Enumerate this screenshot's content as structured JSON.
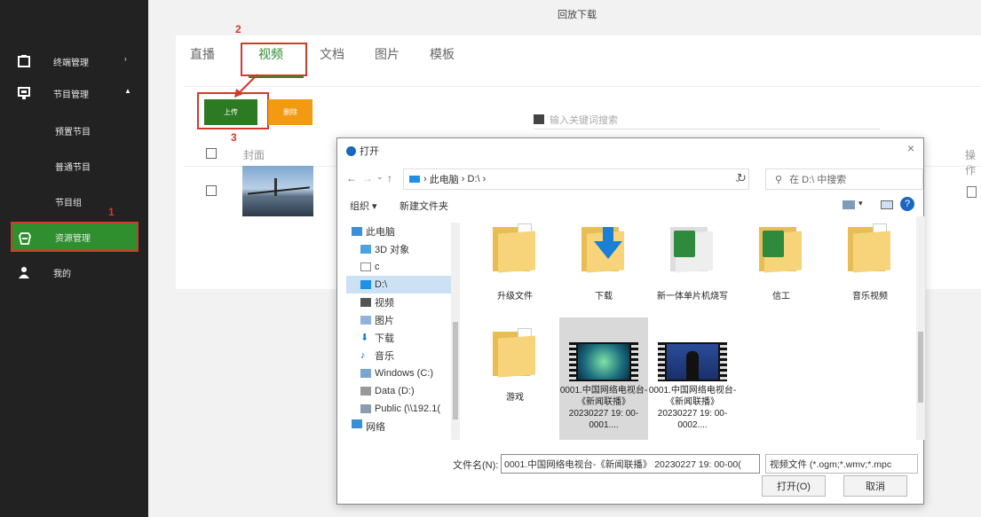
{
  "app": {
    "top_title": "回放下载"
  },
  "sidebar": {
    "items": [
      {
        "label": "终端管理",
        "icon": "terminal-icon"
      },
      {
        "label": "节目管理",
        "icon": "program-icon"
      },
      {
        "label": "预置节目"
      },
      {
        "label": "普通节目"
      },
      {
        "label": "节目组"
      },
      {
        "label": "资源管理",
        "icon": "resource-icon"
      },
      {
        "label": "我的",
        "icon": "user-icon"
      }
    ]
  },
  "annotations": {
    "a1": "1",
    "a2": "2",
    "a3": "3"
  },
  "tabs": [
    {
      "label": "直播"
    },
    {
      "label": "视频"
    },
    {
      "label": "文档"
    },
    {
      "label": "图片"
    },
    {
      "label": "模板"
    }
  ],
  "toolbar": {
    "upload_label": "上传",
    "delete_label": "删除"
  },
  "search": {
    "placeholder": "输入关键词搜索"
  },
  "table": {
    "columns": [
      "封面",
      "操作"
    ]
  },
  "dialog": {
    "title": "打开",
    "close": "×",
    "path": [
      "此电脑",
      "D:\\"
    ],
    "search_placeholder": "在 D:\\ 中搜索",
    "organize": "组织 ▾",
    "new_folder": "新建文件夹",
    "help": "?",
    "tree": [
      {
        "label": "此电脑"
      },
      {
        "label": "3D 对象"
      },
      {
        "label": "c"
      },
      {
        "label": "D:\\"
      },
      {
        "label": "视频"
      },
      {
        "label": "图片"
      },
      {
        "label": "下载"
      },
      {
        "label": "音乐"
      },
      {
        "label": "Windows (C:)"
      },
      {
        "label": "Data (D:)"
      },
      {
        "label": "Public (\\\\192.1("
      },
      {
        "label": "网络"
      }
    ],
    "files": [
      {
        "label": "升级文件"
      },
      {
        "label": "下载"
      },
      {
        "label": "新一体单片机烧写"
      },
      {
        "label": "信工"
      },
      {
        "label": "音乐视频"
      },
      {
        "label": "游戏"
      },
      {
        "label": "0001.中国网络电视台-《新闻联播》20230227 19: 00-0001...."
      },
      {
        "label": "0001.中国网络电视台-《新闻联播》20230227 19: 00-0002...."
      }
    ],
    "filename_label": "文件名(N):",
    "filename_value": "0001.中国网络电视台-《新闻联播》 20230227 19: 00-00(",
    "filter_value": "视频文件 (*.ogm;*.wmv;*.mpc",
    "open_label": "打开(O)",
    "cancel_label": "取消"
  }
}
